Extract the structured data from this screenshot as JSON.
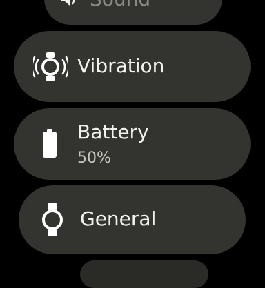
{
  "settings": {
    "items": [
      {
        "label": "Sound",
        "icon": "speaker-icon"
      },
      {
        "label": "Vibration",
        "icon": "vibration-watch-icon"
      },
      {
        "label": "Battery",
        "value": "50%",
        "icon": "battery-icon",
        "level": 0.5
      },
      {
        "label": "General",
        "icon": "watch-icon"
      }
    ]
  },
  "colors": {
    "background": "#000000",
    "chip": "#33332f",
    "text_primary": "#f2f2ee",
    "text_secondary": "#c7c6bf"
  }
}
